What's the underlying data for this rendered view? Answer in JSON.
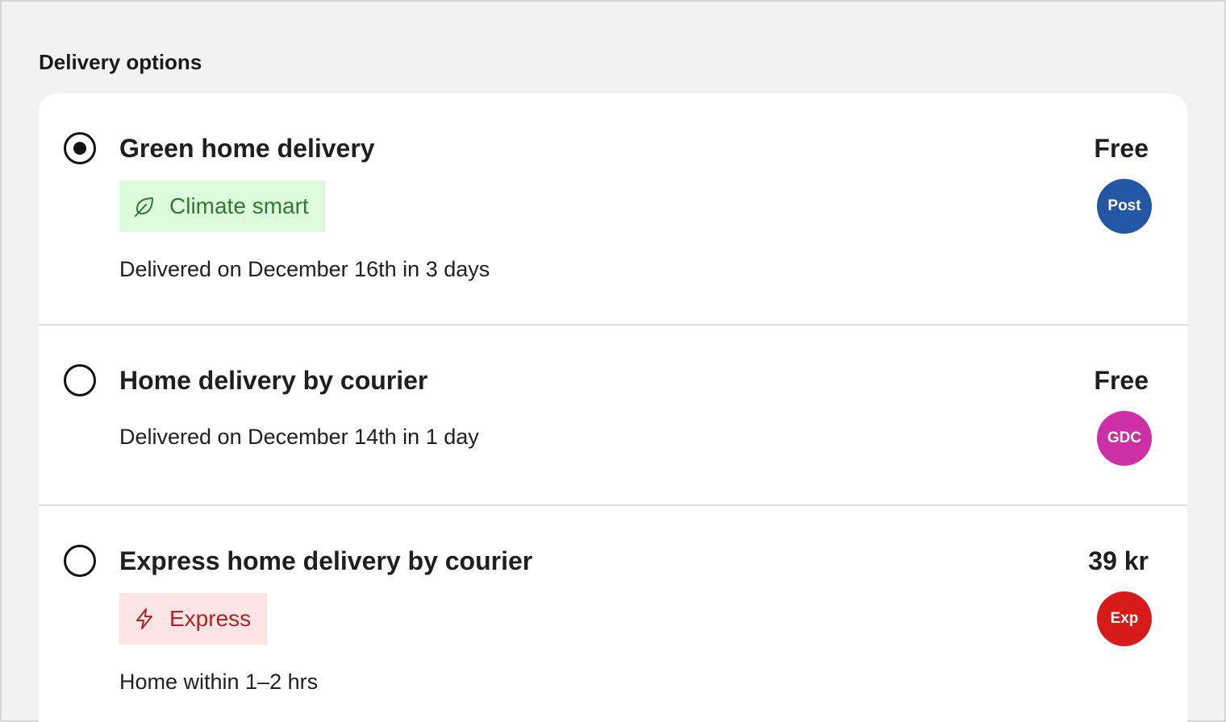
{
  "section_title": "Delivery options",
  "colors": {
    "page_bg": "#f2f2f2",
    "card_bg": "#ffffff",
    "badge_green_bg": "#dcfcdc",
    "badge_green_fg": "#2f7a2f",
    "badge_red_bg": "#fde4e4",
    "badge_red_fg": "#b12424",
    "carrier_post": "#2456a6",
    "carrier_gdc": "#cd2fa6",
    "carrier_exp": "#d71a1a"
  },
  "options": [
    {
      "title": "Green home delivery",
      "price": "Free",
      "selected": true,
      "badge": {
        "label": "Climate smart",
        "icon": "leaf-icon"
      },
      "description": "Delivered on December 16th in 3 days",
      "carrier": "Post"
    },
    {
      "title": "Home delivery by courier",
      "price": "Free",
      "selected": false,
      "description": "Delivered on December 14th in 1 day",
      "carrier": "GDC"
    },
    {
      "title": "Express home delivery by courier",
      "price": "39 kr",
      "selected": false,
      "badge": {
        "label": "Express",
        "icon": "lightning-icon"
      },
      "description": "Home within 1–2 hrs",
      "carrier": "Exp"
    }
  ]
}
